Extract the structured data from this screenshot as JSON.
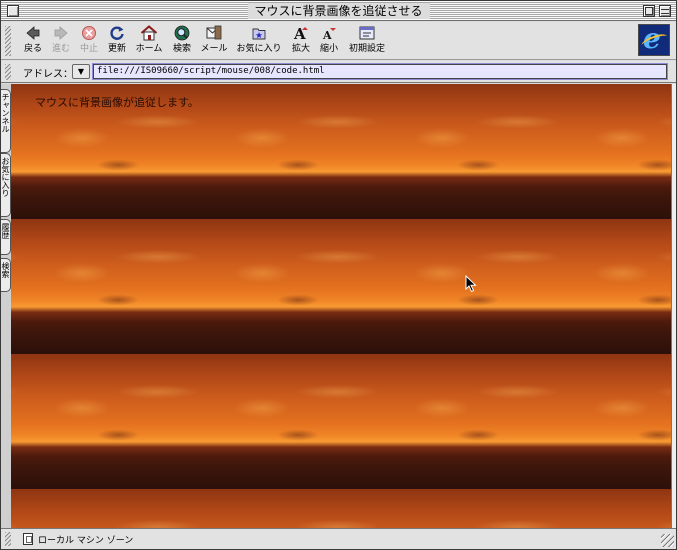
{
  "window": {
    "title": "マウスに背景画像を追従させる"
  },
  "toolbar": {
    "buttons": [
      {
        "label": "戻る",
        "icon": "back-arrow-icon",
        "enabled": true
      },
      {
        "label": "進む",
        "icon": "forward-arrow-icon",
        "enabled": false
      },
      {
        "label": "中止",
        "icon": "stop-icon",
        "enabled": false
      },
      {
        "label": "更新",
        "icon": "refresh-icon",
        "enabled": true
      },
      {
        "label": "ホーム",
        "icon": "home-icon",
        "enabled": true
      },
      {
        "label": "検索",
        "icon": "search-icon",
        "enabled": true
      },
      {
        "label": "メール",
        "icon": "mail-icon",
        "enabled": true
      },
      {
        "label": "お気に入り",
        "icon": "favorites-icon",
        "enabled": true
      },
      {
        "label": "拡大",
        "icon": "text-larger-icon",
        "enabled": true
      },
      {
        "label": "縮小",
        "icon": "text-smaller-icon",
        "enabled": true
      },
      {
        "label": "初期設定",
        "icon": "preferences-icon",
        "enabled": true
      }
    ]
  },
  "address": {
    "label": "アドレス：",
    "url": "file:///IS09660/script/mouse/008/code.html"
  },
  "explorer_tabs": [
    "チャンネル",
    "お気に入り",
    "履歴",
    "検索"
  ],
  "content": {
    "text": "マウスに背景画像が追従します。"
  },
  "status": {
    "zone": "ローカル マシン ゾーン"
  },
  "colors": {
    "address_bg": "#e6e6ff",
    "sunset_orange": "#e4721f",
    "ie_blue": "#0f2b7a"
  }
}
